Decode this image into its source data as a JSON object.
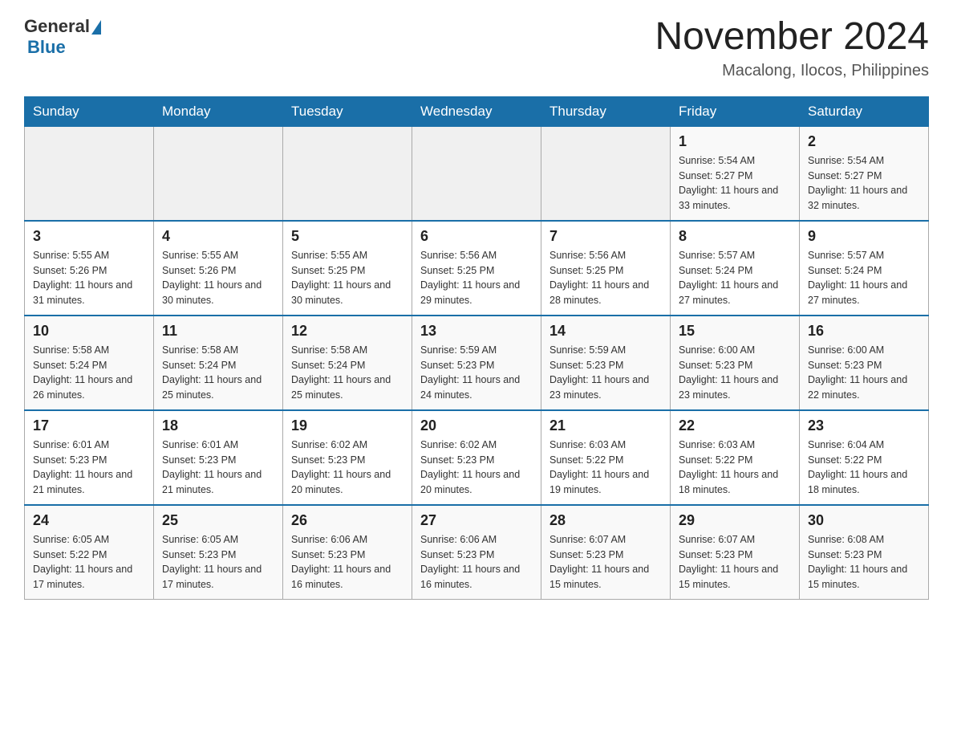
{
  "header": {
    "logo_general": "General",
    "logo_blue": "Blue",
    "month_title": "November 2024",
    "location": "Macalong, Ilocos, Philippines"
  },
  "days_of_week": [
    "Sunday",
    "Monday",
    "Tuesday",
    "Wednesday",
    "Thursday",
    "Friday",
    "Saturday"
  ],
  "weeks": [
    [
      {
        "day": "",
        "info": ""
      },
      {
        "day": "",
        "info": ""
      },
      {
        "day": "",
        "info": ""
      },
      {
        "day": "",
        "info": ""
      },
      {
        "day": "",
        "info": ""
      },
      {
        "day": "1",
        "info": "Sunrise: 5:54 AM\nSunset: 5:27 PM\nDaylight: 11 hours and 33 minutes."
      },
      {
        "day": "2",
        "info": "Sunrise: 5:54 AM\nSunset: 5:27 PM\nDaylight: 11 hours and 32 minutes."
      }
    ],
    [
      {
        "day": "3",
        "info": "Sunrise: 5:55 AM\nSunset: 5:26 PM\nDaylight: 11 hours and 31 minutes."
      },
      {
        "day": "4",
        "info": "Sunrise: 5:55 AM\nSunset: 5:26 PM\nDaylight: 11 hours and 30 minutes."
      },
      {
        "day": "5",
        "info": "Sunrise: 5:55 AM\nSunset: 5:25 PM\nDaylight: 11 hours and 30 minutes."
      },
      {
        "day": "6",
        "info": "Sunrise: 5:56 AM\nSunset: 5:25 PM\nDaylight: 11 hours and 29 minutes."
      },
      {
        "day": "7",
        "info": "Sunrise: 5:56 AM\nSunset: 5:25 PM\nDaylight: 11 hours and 28 minutes."
      },
      {
        "day": "8",
        "info": "Sunrise: 5:57 AM\nSunset: 5:24 PM\nDaylight: 11 hours and 27 minutes."
      },
      {
        "day": "9",
        "info": "Sunrise: 5:57 AM\nSunset: 5:24 PM\nDaylight: 11 hours and 27 minutes."
      }
    ],
    [
      {
        "day": "10",
        "info": "Sunrise: 5:58 AM\nSunset: 5:24 PM\nDaylight: 11 hours and 26 minutes."
      },
      {
        "day": "11",
        "info": "Sunrise: 5:58 AM\nSunset: 5:24 PM\nDaylight: 11 hours and 25 minutes."
      },
      {
        "day": "12",
        "info": "Sunrise: 5:58 AM\nSunset: 5:24 PM\nDaylight: 11 hours and 25 minutes."
      },
      {
        "day": "13",
        "info": "Sunrise: 5:59 AM\nSunset: 5:23 PM\nDaylight: 11 hours and 24 minutes."
      },
      {
        "day": "14",
        "info": "Sunrise: 5:59 AM\nSunset: 5:23 PM\nDaylight: 11 hours and 23 minutes."
      },
      {
        "day": "15",
        "info": "Sunrise: 6:00 AM\nSunset: 5:23 PM\nDaylight: 11 hours and 23 minutes."
      },
      {
        "day": "16",
        "info": "Sunrise: 6:00 AM\nSunset: 5:23 PM\nDaylight: 11 hours and 22 minutes."
      }
    ],
    [
      {
        "day": "17",
        "info": "Sunrise: 6:01 AM\nSunset: 5:23 PM\nDaylight: 11 hours and 21 minutes."
      },
      {
        "day": "18",
        "info": "Sunrise: 6:01 AM\nSunset: 5:23 PM\nDaylight: 11 hours and 21 minutes."
      },
      {
        "day": "19",
        "info": "Sunrise: 6:02 AM\nSunset: 5:23 PM\nDaylight: 11 hours and 20 minutes."
      },
      {
        "day": "20",
        "info": "Sunrise: 6:02 AM\nSunset: 5:23 PM\nDaylight: 11 hours and 20 minutes."
      },
      {
        "day": "21",
        "info": "Sunrise: 6:03 AM\nSunset: 5:22 PM\nDaylight: 11 hours and 19 minutes."
      },
      {
        "day": "22",
        "info": "Sunrise: 6:03 AM\nSunset: 5:22 PM\nDaylight: 11 hours and 18 minutes."
      },
      {
        "day": "23",
        "info": "Sunrise: 6:04 AM\nSunset: 5:22 PM\nDaylight: 11 hours and 18 minutes."
      }
    ],
    [
      {
        "day": "24",
        "info": "Sunrise: 6:05 AM\nSunset: 5:22 PM\nDaylight: 11 hours and 17 minutes."
      },
      {
        "day": "25",
        "info": "Sunrise: 6:05 AM\nSunset: 5:23 PM\nDaylight: 11 hours and 17 minutes."
      },
      {
        "day": "26",
        "info": "Sunrise: 6:06 AM\nSunset: 5:23 PM\nDaylight: 11 hours and 16 minutes."
      },
      {
        "day": "27",
        "info": "Sunrise: 6:06 AM\nSunset: 5:23 PM\nDaylight: 11 hours and 16 minutes."
      },
      {
        "day": "28",
        "info": "Sunrise: 6:07 AM\nSunset: 5:23 PM\nDaylight: 11 hours and 15 minutes."
      },
      {
        "day": "29",
        "info": "Sunrise: 6:07 AM\nSunset: 5:23 PM\nDaylight: 11 hours and 15 minutes."
      },
      {
        "day": "30",
        "info": "Sunrise: 6:08 AM\nSunset: 5:23 PM\nDaylight: 11 hours and 15 minutes."
      }
    ]
  ]
}
